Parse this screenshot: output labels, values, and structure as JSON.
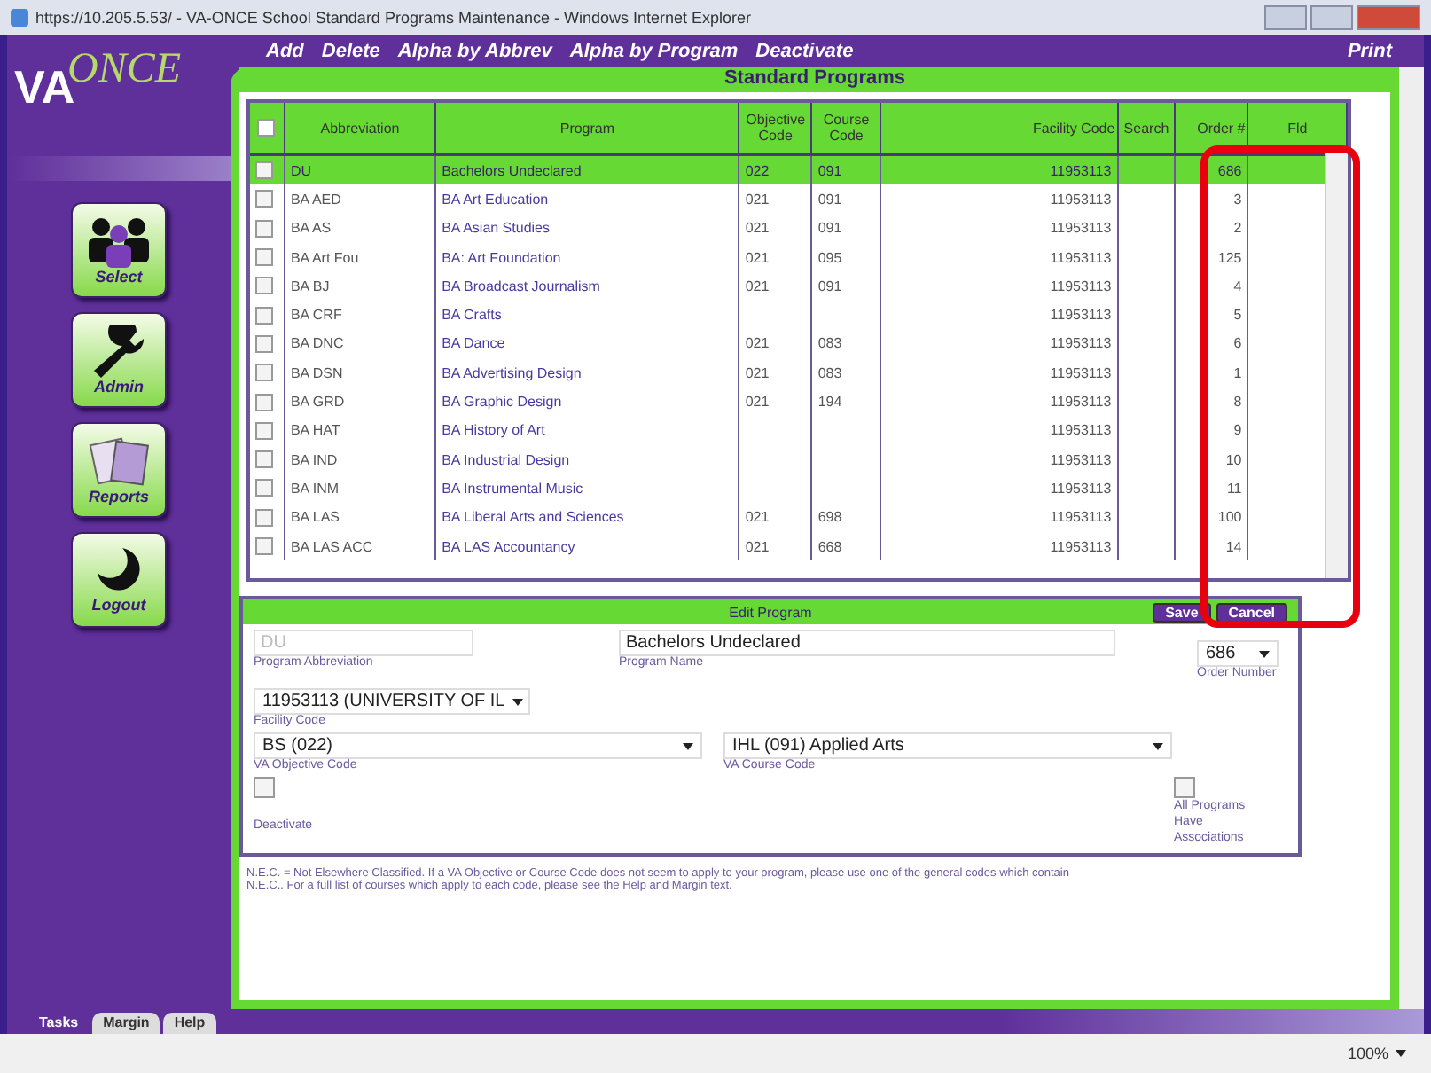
{
  "window": {
    "title": "https://10.205.5.53/ - VA-ONCE School Standard Programs Maintenance - Windows Internet Explorer"
  },
  "logo": {
    "text": "VA",
    "script": "ONCE"
  },
  "menu": [
    "Add",
    "Delete",
    "Alpha by Abbrev",
    "Alpha by Program",
    "Deactivate"
  ],
  "print": "Print",
  "sidebar": {
    "items": [
      {
        "label": "Select",
        "kind": "people"
      },
      {
        "label": "Admin",
        "kind": "wrench"
      },
      {
        "label": "Reports",
        "kind": "papers"
      },
      {
        "label": "Logout",
        "kind": "moon"
      }
    ]
  },
  "panel_title": "Standard Programs",
  "table": {
    "all_selected": false,
    "columns": [
      "Abbreviation",
      "Program",
      "Objective Code",
      "Course Code",
      "Facility Code",
      "Search",
      "Order #",
      "Fld"
    ],
    "rows": [
      {
        "selected": true,
        "cells": [
          "DU",
          "Bachelors Undeclared",
          "022",
          "091",
          "11953113",
          "",
          "686"
        ]
      },
      {
        "selected": false,
        "cells": [
          "BA AED",
          "BA Art Education",
          "021",
          "091",
          "11953113",
          "",
          "3"
        ]
      },
      {
        "selected": false,
        "cells": [
          "BA AS",
          "BA Asian Studies",
          "021",
          "091",
          "11953113",
          "",
          "2"
        ]
      },
      {
        "selected": false,
        "cells": [
          "BA Art Fou",
          "BA: Art Foundation",
          "021",
          "095",
          "11953113",
          "",
          "125"
        ]
      },
      {
        "selected": false,
        "cells": [
          "BA BJ",
          "BA Broadcast Journalism",
          "021",
          "091",
          "11953113",
          "",
          "4"
        ]
      },
      {
        "selected": false,
        "cells": [
          "BA CRF",
          "BA Crafts",
          "",
          "",
          "11953113",
          "",
          "5"
        ]
      },
      {
        "selected": false,
        "cells": [
          "BA DNC",
          "BA Dance",
          "021",
          "083",
          "11953113",
          "",
          "6"
        ]
      },
      {
        "selected": false,
        "cells": [
          "BA DSN",
          "BA Advertising Design",
          "021",
          "083",
          "11953113",
          "",
          "1"
        ]
      },
      {
        "selected": false,
        "cells": [
          "BA GRD",
          "BA Graphic Design",
          "021",
          "194",
          "11953113",
          "",
          "8"
        ]
      },
      {
        "selected": false,
        "cells": [
          "BA HAT",
          "BA History of Art",
          "",
          "",
          "11953113",
          "",
          "9"
        ]
      },
      {
        "selected": false,
        "cells": [
          "BA IND",
          "BA Industrial Design",
          "",
          "",
          "11953113",
          "",
          "10"
        ]
      },
      {
        "selected": false,
        "cells": [
          "BA INM",
          "BA Instrumental Music",
          "",
          "",
          "11953113",
          "",
          "11"
        ]
      },
      {
        "selected": false,
        "cells": [
          "BA LAS",
          "BA Liberal Arts and Sciences",
          "021",
          "698",
          "11953113",
          "",
          "100"
        ]
      },
      {
        "selected": false,
        "cells": [
          "BA LAS ACC",
          "BA LAS Accountancy",
          "021",
          "668",
          "11953113",
          "",
          "14"
        ]
      }
    ]
  },
  "edit": {
    "title": "Edit Program",
    "save": "Save",
    "cancel": "Cancel",
    "abbrev": {
      "value": "DU",
      "label": "Program Abbreviation",
      "disabled": true
    },
    "name": {
      "value": "Bachelors Undeclared",
      "label": "Program Name"
    },
    "order": {
      "value": "686",
      "label": "Order Number"
    },
    "facility": {
      "value": "11953113 (UNIVERSITY OF IL",
      "label": "Facility Code"
    },
    "objective": {
      "value": "BS (022)",
      "label": "VA Objective Code"
    },
    "course": {
      "value": "IHL (091) Applied Arts",
      "label": "VA Course Code"
    },
    "deactivate": {
      "label": "Deactivate",
      "checked": false
    },
    "all_programs": {
      "label": "All Programs Have Associations",
      "checked": false
    }
  },
  "note": [
    "N.E.C. = Not Elsewhere Classified. If a VA Objective or Course Code does not seem to apply to your program, please use one of the general codes which contain",
    "N.E.C.. For a full list of courses which apply to each code, please see the Help and Margin text."
  ],
  "bottom_tabs": [
    {
      "label": "Tasks",
      "selected": true
    },
    {
      "label": "Margin",
      "selected": false
    },
    {
      "label": "Help",
      "selected": false
    }
  ],
  "status_bar": {
    "zoom": "100%"
  }
}
